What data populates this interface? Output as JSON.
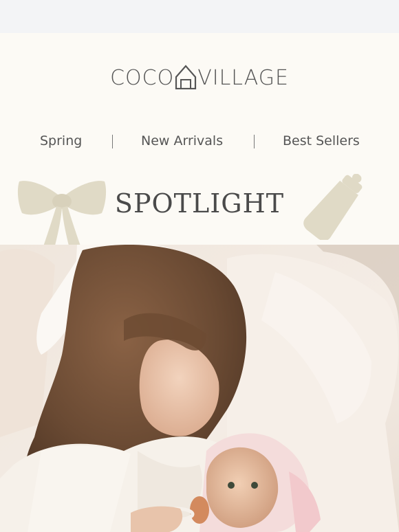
{
  "brand": {
    "logo_left": "COCO",
    "logo_right": "VILLAGE"
  },
  "nav": {
    "items": [
      {
        "label": "Spring"
      },
      {
        "label": "New Arrivals"
      },
      {
        "label": "Best Sellers"
      }
    ]
  },
  "spotlight": {
    "title": "SPOTLIGHT"
  },
  "colors": {
    "background": "#fcfaf5",
    "accent_beige": "#e0dac6",
    "text": "#555555"
  }
}
